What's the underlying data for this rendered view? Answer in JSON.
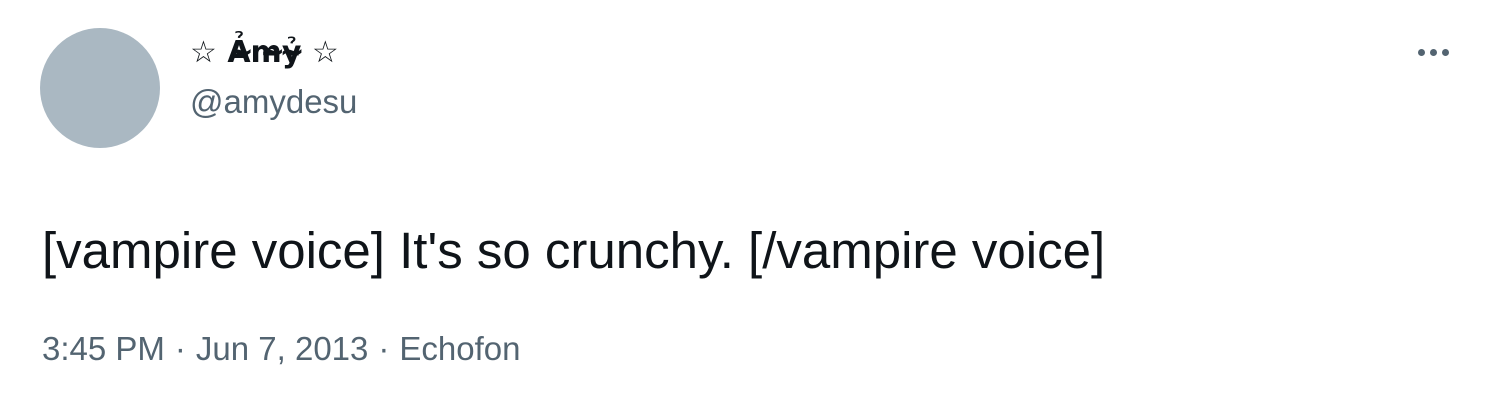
{
  "author": {
    "display_name": "☆ Ả̵̴̵m̵̴̵ỷ̵̴̵ ☆",
    "handle": "@amydesu"
  },
  "tweet": {
    "text": "[vampire voice] It's so crunchy. [/vampire voice]",
    "time": "3:45 PM",
    "separator": "·",
    "date": "Jun 7, 2013",
    "source": "Echofon"
  },
  "icons": {
    "more": "more-horizontal-icon"
  },
  "colors": {
    "avatar_placeholder": "#aab8c2",
    "secondary_text": "#536471",
    "primary_text": "#0f1419"
  }
}
